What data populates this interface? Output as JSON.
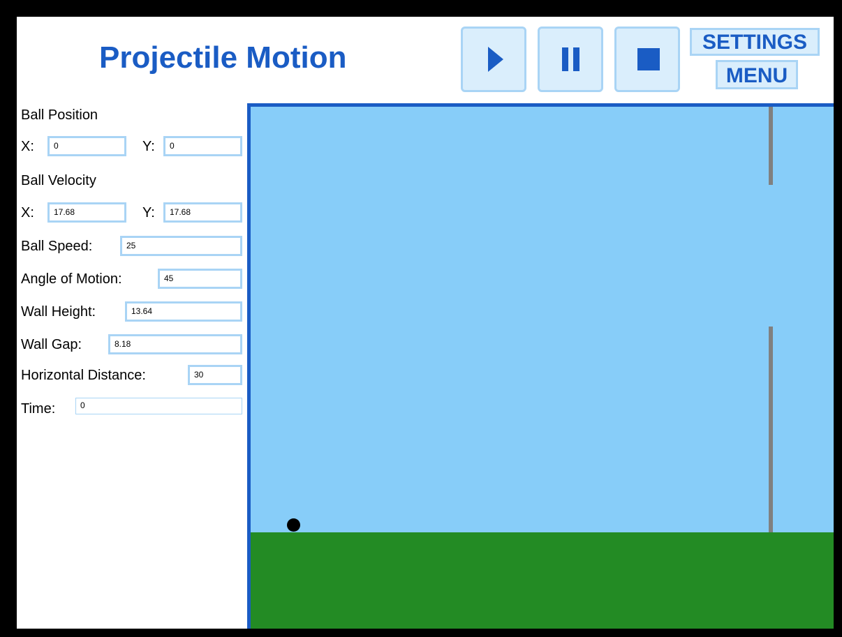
{
  "app": {
    "title": "Projectile Motion"
  },
  "controls": {
    "play_icon": "play-icon",
    "pause_icon": "pause-icon",
    "stop_icon": "stop-icon",
    "settings_label": "SETTINGS",
    "menu_label": "MENU"
  },
  "panel": {
    "ball_position": {
      "heading": "Ball Position",
      "x_label": "X:",
      "x_value": "0",
      "y_label": "Y:",
      "y_value": "0"
    },
    "ball_velocity": {
      "heading": "Ball Velocity",
      "x_label": "X:",
      "x_value": "17.68",
      "y_label": "Y:",
      "y_value": "17.68"
    },
    "ball_speed": {
      "label": "Ball Speed:",
      "value": "25"
    },
    "angle_of_motion": {
      "label": "Angle of Motion:",
      "value": "45"
    },
    "wall_height": {
      "label": "Wall Height:",
      "value": "13.64"
    },
    "wall_gap": {
      "label": "Wall Gap:",
      "value": "8.18"
    },
    "horizontal_distance": {
      "label": "Horizontal Distance:",
      "value": "30"
    },
    "time": {
      "label": "Time:",
      "value": "0"
    }
  },
  "colors": {
    "accent": "#1a5cc4",
    "button_fill": "#daeefc",
    "button_border": "#a9d4f5",
    "sky": "#87cdf9",
    "ground": "#238b24",
    "wall": "#808080",
    "ball": "#000000",
    "frame": "#000000"
  }
}
